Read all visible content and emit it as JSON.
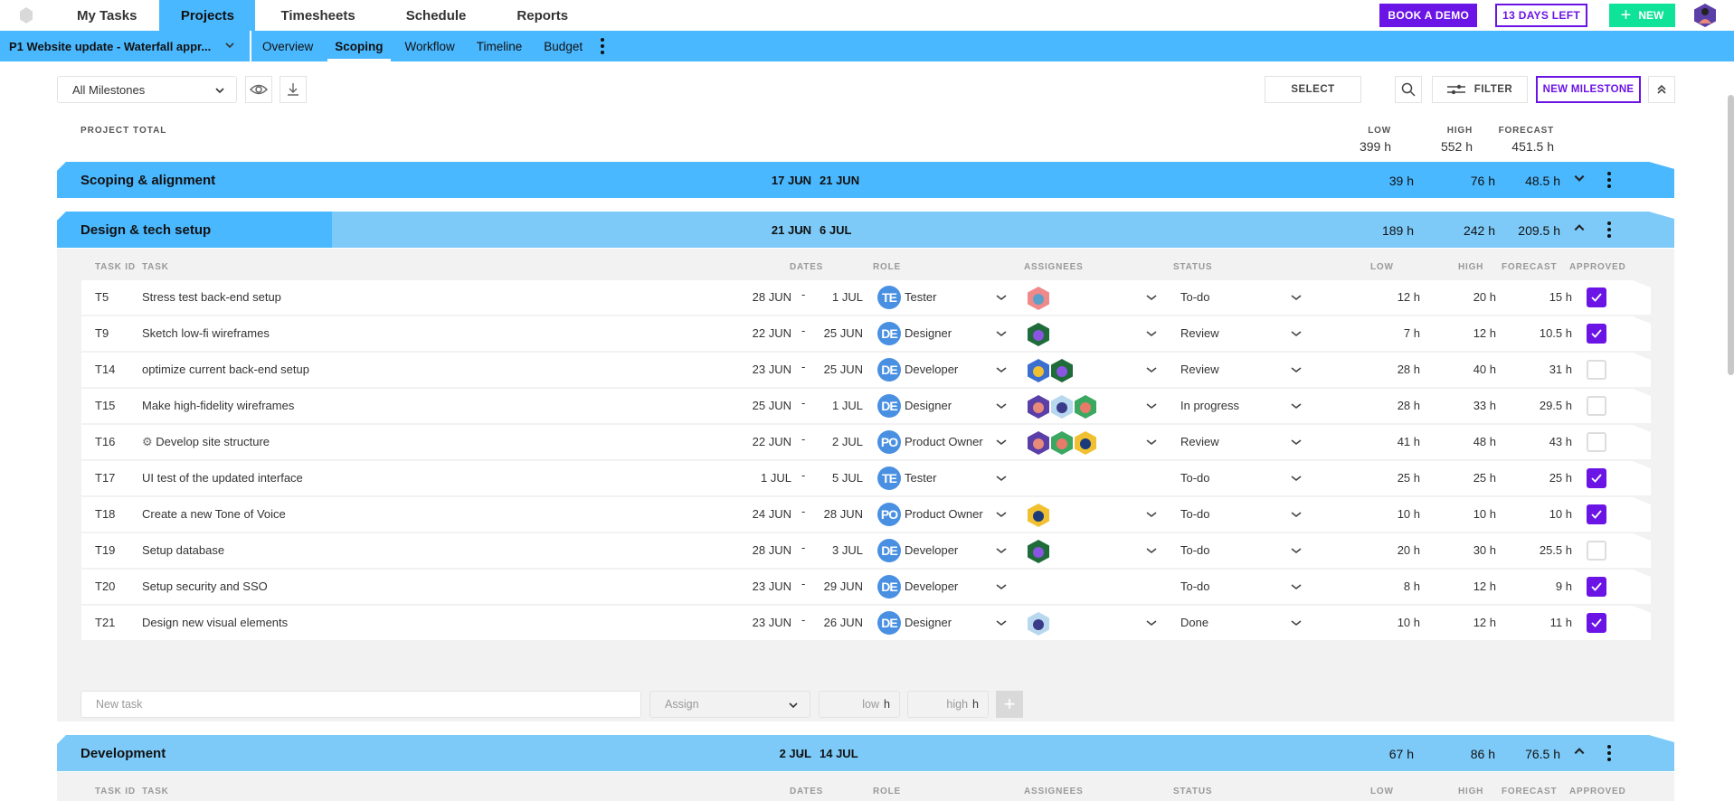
{
  "topnav": {
    "items": [
      {
        "label": "My Tasks",
        "active": false
      },
      {
        "label": "Projects",
        "active": true
      },
      {
        "label": "Timesheets",
        "active": false
      },
      {
        "label": "Schedule",
        "active": false
      },
      {
        "label": "Reports",
        "active": false
      }
    ],
    "book_demo": "BOOK A DEMO",
    "trial": "13 DAYS LEFT",
    "new": "NEW",
    "new_icon": "plus-icon"
  },
  "subnav": {
    "project": "P1  Website update - Waterfall appr...",
    "tabs": [
      {
        "label": "Overview",
        "active": false
      },
      {
        "label": "Scoping",
        "active": true
      },
      {
        "label": "Workflow",
        "active": false
      },
      {
        "label": "Timeline",
        "active": false
      },
      {
        "label": "Budget",
        "active": false
      }
    ]
  },
  "toolbar": {
    "milestone_filter": "All Milestones",
    "select": "SELECT",
    "filter": "FILTER",
    "new_milestone": "NEW MILESTONE"
  },
  "project_total": {
    "label": "PROJECT TOTAL",
    "low_label": "LOW",
    "high_label": "HIGH",
    "forecast_label": "FORECAST",
    "low": "399 h",
    "high": "552 h",
    "forecast": "451.5 h"
  },
  "columns": {
    "task_id": "TASK ID",
    "task": "TASK",
    "dates": "DATES",
    "role": "ROLE",
    "assignees": "ASSIGNEES",
    "status": "STATUS",
    "low": "LOW",
    "high": "HIGH",
    "forecast": "FORECAST",
    "approved": "APPROVED"
  },
  "milestones": [
    {
      "title": "Scoping & alignment",
      "start": "17 JUN",
      "end": "21 JUN",
      "low": "39 h",
      "high": "76 h",
      "forecast": "48.5 h",
      "expanded": false,
      "progress": 1.0
    },
    {
      "title": "Design & tech setup",
      "start": "21 JUN",
      "end": "6 JUL",
      "low": "189 h",
      "high": "242 h",
      "forecast": "209.5 h",
      "expanded": true,
      "progress": 0.17
    },
    {
      "title": "Development",
      "start": "2 JUL",
      "end": "14 JUL",
      "low": "67 h",
      "high": "86 h",
      "forecast": "76.5 h",
      "expanded": true,
      "progress": 0
    }
  ],
  "dash": "-",
  "tasks": [
    {
      "id": "T5",
      "name": "Stress test back-end setup",
      "start": "28 JUN",
      "end": "1 JUL",
      "role_abbr": "TE",
      "role": "Tester",
      "assignees": [
        "pink-robot"
      ],
      "status": "To-do",
      "low": "12 h",
      "high": "20 h",
      "forecast": "15 h",
      "approved": true
    },
    {
      "id": "T9",
      "name": "Sketch low-fi wireframes",
      "start": "22 JUN",
      "end": "25 JUN",
      "role_abbr": "DE",
      "role": "Designer",
      "assignees": [
        "green-robot"
      ],
      "status": "Review",
      "low": "7 h",
      "high": "12 h",
      "forecast": "10.5 h",
      "approved": true
    },
    {
      "id": "T14",
      "name": "optimize current back-end setup",
      "start": "23 JUN",
      "end": "25 JUN",
      "role_abbr": "DE",
      "role": "Developer",
      "assignees": [
        "blue-cone",
        "green-robot"
      ],
      "status": "Review",
      "low": "28 h",
      "high": "40 h",
      "forecast": "31 h",
      "approved": false
    },
    {
      "id": "T15",
      "name": "Make high-fidelity wireframes",
      "start": "25 JUN",
      "end": "1 JUL",
      "role_abbr": "DE",
      "role": "Designer",
      "assignees": [
        "purple-figure",
        "lightblue-robot",
        "green-monster"
      ],
      "status": "In progress",
      "low": "28 h",
      "high": "33 h",
      "forecast": "29.5 h",
      "approved": false
    },
    {
      "id": "T16",
      "name": "Develop site structure",
      "has_bug_icon": true,
      "start": "22 JUN",
      "end": "2 JUL",
      "role_abbr": "PO",
      "role": "Product Owner",
      "assignees": [
        "purple-figure",
        "green-monster",
        "yellow-navy"
      ],
      "status": "Review",
      "low": "41 h",
      "high": "48 h",
      "forecast": "43 h",
      "approved": false
    },
    {
      "id": "T17",
      "name": "UI test of the updated interface",
      "start": "1 JUL",
      "end": "5 JUL",
      "role_abbr": "TE",
      "role": "Tester",
      "assignees": [],
      "status": "To-do",
      "low": "25 h",
      "high": "25 h",
      "forecast": "25 h",
      "approved": true
    },
    {
      "id": "T18",
      "name": "Create a new Tone of Voice",
      "start": "24 JUN",
      "end": "28 JUN",
      "role_abbr": "PO",
      "role": "Product Owner",
      "assignees": [
        "yellow-navy"
      ],
      "status": "To-do",
      "low": "10 h",
      "high": "10 h",
      "forecast": "10 h",
      "approved": true
    },
    {
      "id": "T19",
      "name": "Setup database",
      "start": "28 JUN",
      "end": "3 JUL",
      "role_abbr": "DE",
      "role": "Developer",
      "assignees": [
        "green-robot"
      ],
      "status": "To-do",
      "low": "20 h",
      "high": "30 h",
      "forecast": "25.5 h",
      "approved": false
    },
    {
      "id": "T20",
      "name": "Setup security and SSO",
      "start": "23 JUN",
      "end": "29 JUN",
      "role_abbr": "DE",
      "role": "Developer",
      "assignees": [],
      "status": "To-do",
      "low": "8 h",
      "high": "12 h",
      "forecast": "9 h",
      "approved": true
    },
    {
      "id": "T21",
      "name": "Design new visual elements",
      "start": "23 JUN",
      "end": "26 JUN",
      "role_abbr": "DE",
      "role": "Designer",
      "assignees": [
        "lightblue-robot"
      ],
      "status": "Done",
      "low": "10 h",
      "high": "12 h",
      "forecast": "11 h",
      "approved": true
    }
  ],
  "new_task": {
    "placeholder": "New task",
    "assign_placeholder": "Assign",
    "low_placeholder": "low",
    "high_placeholder": "high",
    "unit": "h"
  },
  "colors": {
    "accent_blue": "#4ab8ff",
    "light_blue": "#7dcaf9",
    "purple": "#6b14e6",
    "green": "#0fe39a",
    "role_badge": "#4a90e2"
  }
}
